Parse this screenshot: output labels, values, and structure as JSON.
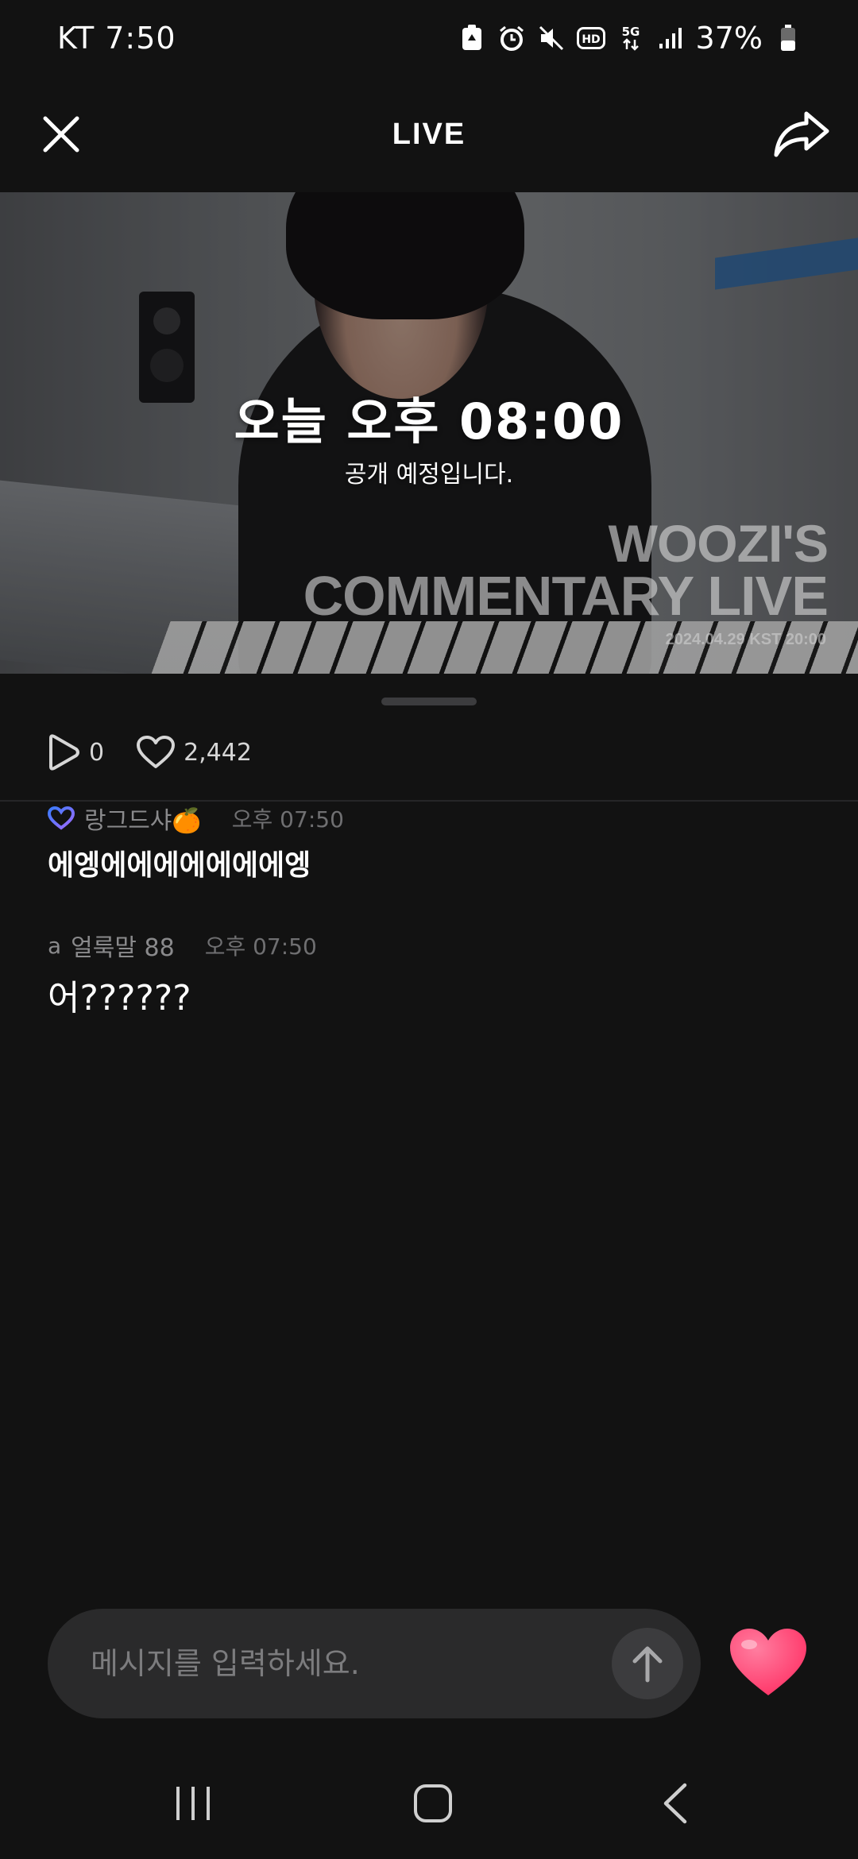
{
  "status_bar": {
    "carrier_time": "KT 7:50",
    "battery_percent": "37%",
    "icons": [
      "recycle-icon",
      "alarm-icon",
      "mute-icon",
      "hd-icon",
      "5g-icon",
      "signal-icon",
      "battery-icon"
    ]
  },
  "header": {
    "title": "LIVE",
    "close_icon": "close-icon",
    "share_icon": "share-icon"
  },
  "banner": {
    "scheduled_time": "오늘 오후 08:00",
    "subtitle": "공개 예정입니다.",
    "watermark_line1": "WOOZI'S",
    "watermark_line2": "COMMENTARY LIVE",
    "watermark_date": "2024.04.29 KST 20:00"
  },
  "stats": {
    "plays": "0",
    "likes": "2,442"
  },
  "comments": [
    {
      "badge": "heart-badge-icon",
      "user": "랑그드샤🍊",
      "time": "오후 07:50",
      "text": "에엥에에에에에에에엥"
    },
    {
      "prefix": "a",
      "user": "얼룩말 88",
      "time": "오후 07:50",
      "text": "어??????"
    }
  ],
  "input": {
    "placeholder": "메시지를 입력하세요."
  },
  "colors": {
    "background": "#121212",
    "input_bg": "#2a2a2b",
    "heart": "#ff3d6e",
    "badge_gradient": [
      "#3b7bff",
      "#a06bff"
    ]
  }
}
